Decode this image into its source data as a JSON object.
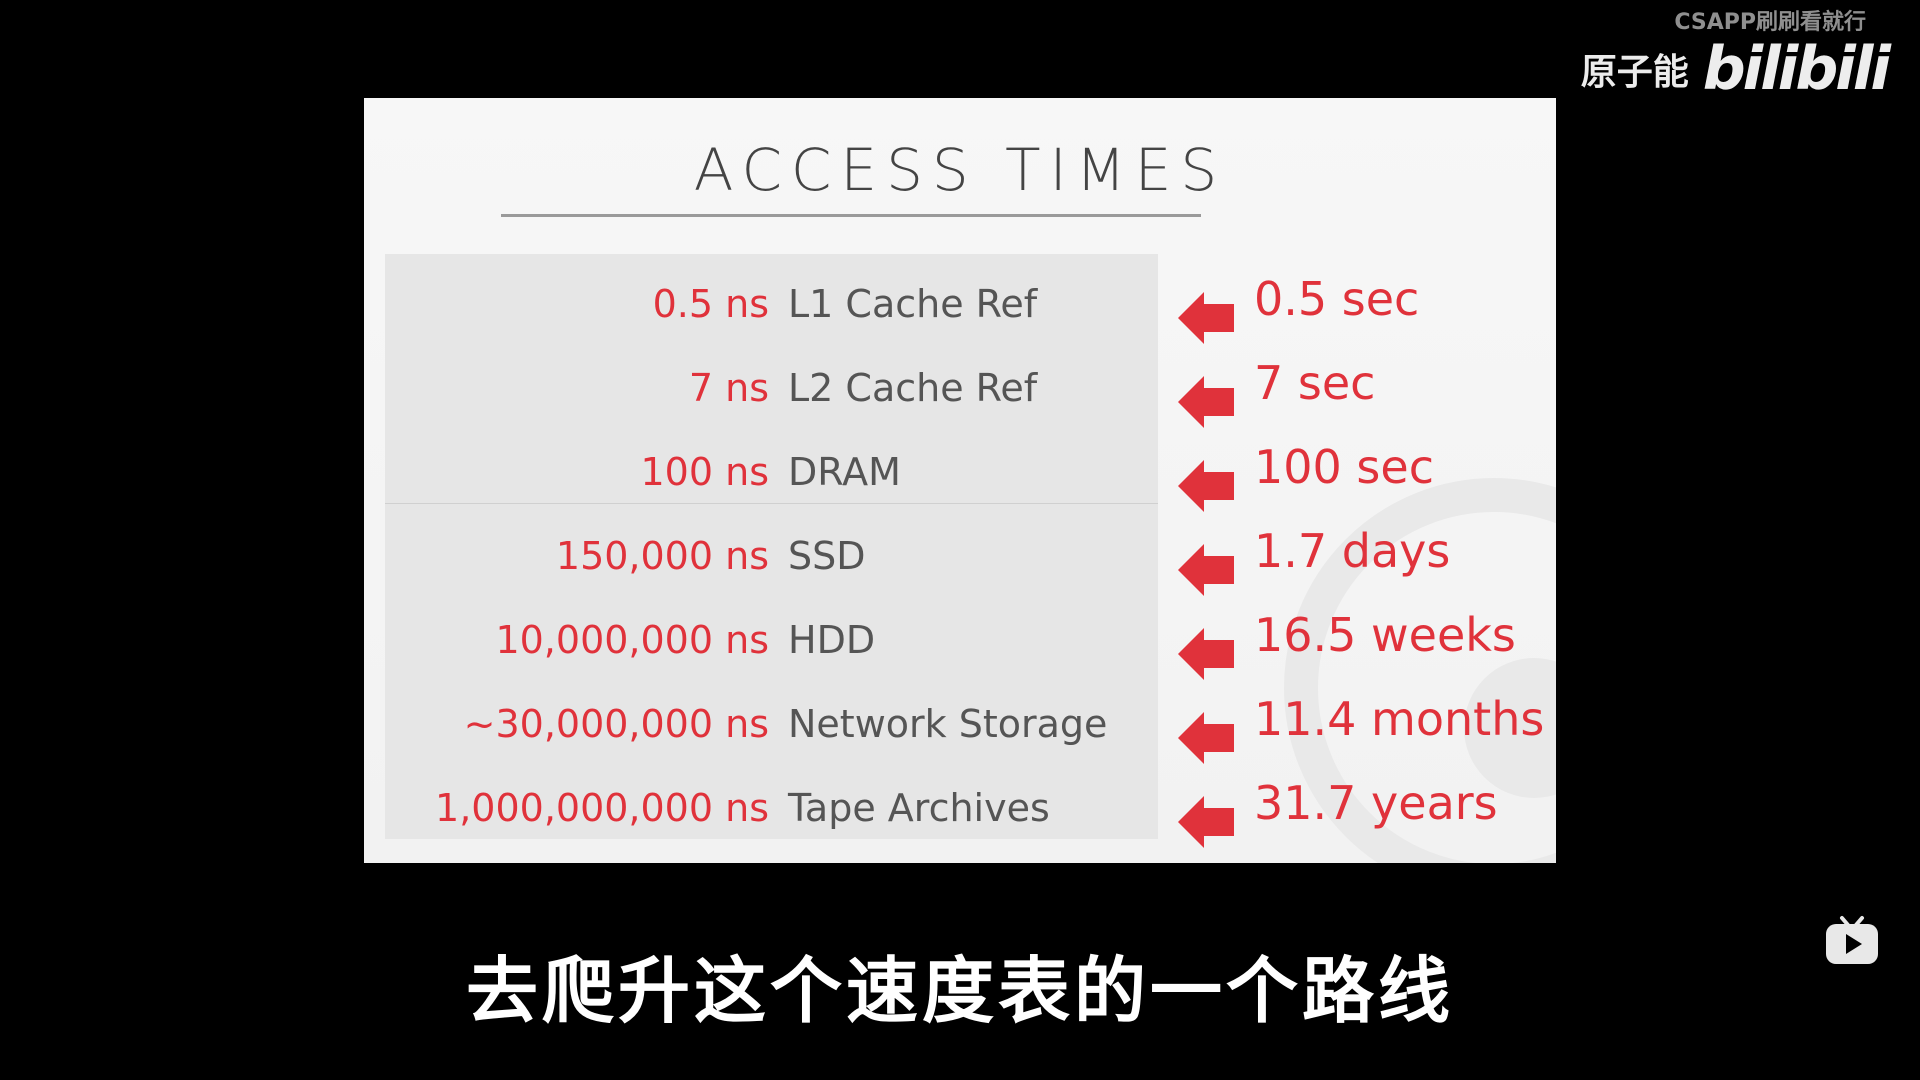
{
  "overlay": {
    "channel_watermark": "CSAPP刷刷看就行",
    "brand_author": "原子能",
    "brand_logo": "bilibili"
  },
  "slide": {
    "title": "ACCESS TIMES",
    "rows": [
      {
        "value": "0.5 ns",
        "label": "L1 Cache Ref",
        "human": "0.5 sec"
      },
      {
        "value": "7 ns",
        "label": "L2 Cache Ref",
        "human": "7 sec"
      },
      {
        "value": "100 ns",
        "label": "DRAM",
        "human": "100 sec"
      },
      {
        "value": "150,000 ns",
        "label": "SSD",
        "human": "1.7 days"
      },
      {
        "value": "10,000,000 ns",
        "label": "HDD",
        "human": "16.5 weeks"
      },
      {
        "value": "~30,000,000 ns",
        "label": "Network Storage",
        "human": "11.4 months"
      },
      {
        "value": "1,000,000,000 ns",
        "label": "Tape Archives",
        "human": "31.7 years"
      }
    ]
  },
  "subtitle": "去爬升这个速度表的一个路线",
  "icons": {
    "arrow": "left-arrow-icon",
    "tv": "bilibili-tv-icon"
  },
  "colors": {
    "accent": "#e0323b",
    "label": "#555555",
    "slide_bg": "#f4f4f4",
    "panel_bg": "#e6e6e6"
  }
}
